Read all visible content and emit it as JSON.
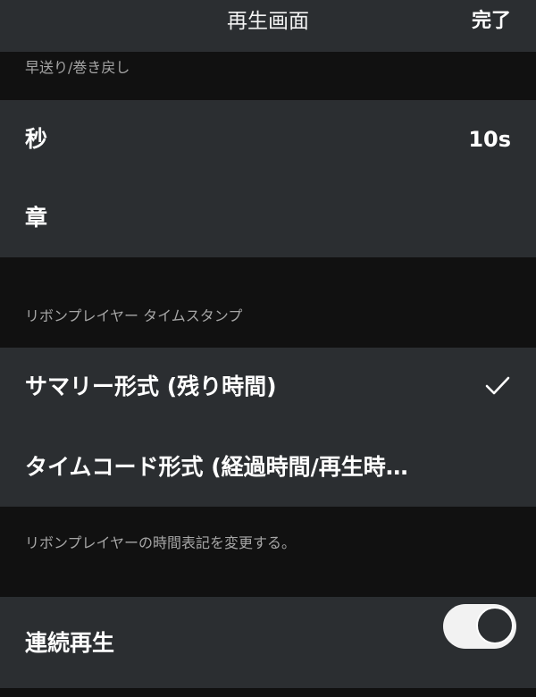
{
  "nav": {
    "title": "再生画面",
    "done_label": "完了"
  },
  "sections": {
    "skip": {
      "header": "早送り/巻き戻し",
      "rows": [
        {
          "label": "秒",
          "value": "10s"
        },
        {
          "label": "章"
        }
      ]
    },
    "timestamp": {
      "header": "リボンプレイヤー タイムスタンプ",
      "rows": [
        {
          "label": "サマリー形式 (残り時間)",
          "selected": true
        },
        {
          "label": "タイムコード形式 (経過時間/再生時…",
          "selected": false
        }
      ],
      "footnote": "リボンプレイヤーの時間表記を変更する。"
    },
    "continuous": {
      "rows": [
        {
          "label": "連続再生",
          "toggle_on": true
        }
      ]
    }
  },
  "icons": {
    "check": "check-icon"
  },
  "colors": {
    "background": "#111111",
    "group_background": "#2b2e31",
    "secondary_text": "#a6a6a6",
    "primary_text": "#ffffff",
    "toggle_track": "#f2f2f2"
  }
}
